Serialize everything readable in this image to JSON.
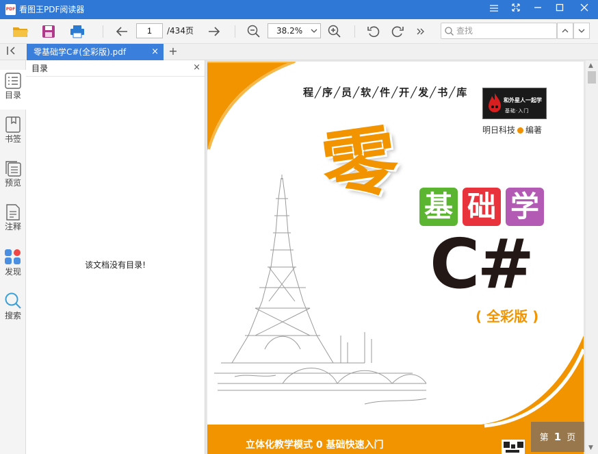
{
  "app": {
    "logo_text": "PDF",
    "title": "看图王PDF阅读器"
  },
  "toolbar": {
    "page_current": "1",
    "page_total": "/434页",
    "zoom_value": "38.2%",
    "search_placeholder": "查找"
  },
  "tabs": {
    "active_label": "零基础学C#(全彩版).pdf",
    "close_glyph": "×",
    "add_glyph": "+"
  },
  "rail": {
    "items": [
      {
        "label": "目录",
        "icon": "outline-icon"
      },
      {
        "label": "书签",
        "icon": "bookmark-icon"
      },
      {
        "label": "预览",
        "icon": "thumbnails-icon"
      },
      {
        "label": "注释",
        "icon": "annotation-icon"
      },
      {
        "label": "发现",
        "icon": "discover-icon"
      },
      {
        "label": "搜索",
        "icon": "search-icon"
      }
    ]
  },
  "panel": {
    "title": "目录",
    "empty_message": "该文档没有目录!"
  },
  "cover": {
    "series": "程╱序╱员╱软╱件╱开╱发╱书╱库",
    "publisher_logo_line1": "和外星人一起学",
    "publisher_logo_line2": "基础·入门",
    "author_name": "明日科技",
    "author_role": "编著",
    "char_ling": "零",
    "char_ji": "基",
    "char_chu": "础",
    "char_xue": "学",
    "language": "C#",
    "edition": "( 全彩版 )",
    "tagline": "立体化教学模式  0 基础快速入门",
    "colors": {
      "orange": "#f29400",
      "green": "#5cb531",
      "red": "#e8323c",
      "purple": "#b35ab5"
    }
  },
  "page_indicator": {
    "prefix": "第",
    "number": "1",
    "suffix": "页"
  }
}
